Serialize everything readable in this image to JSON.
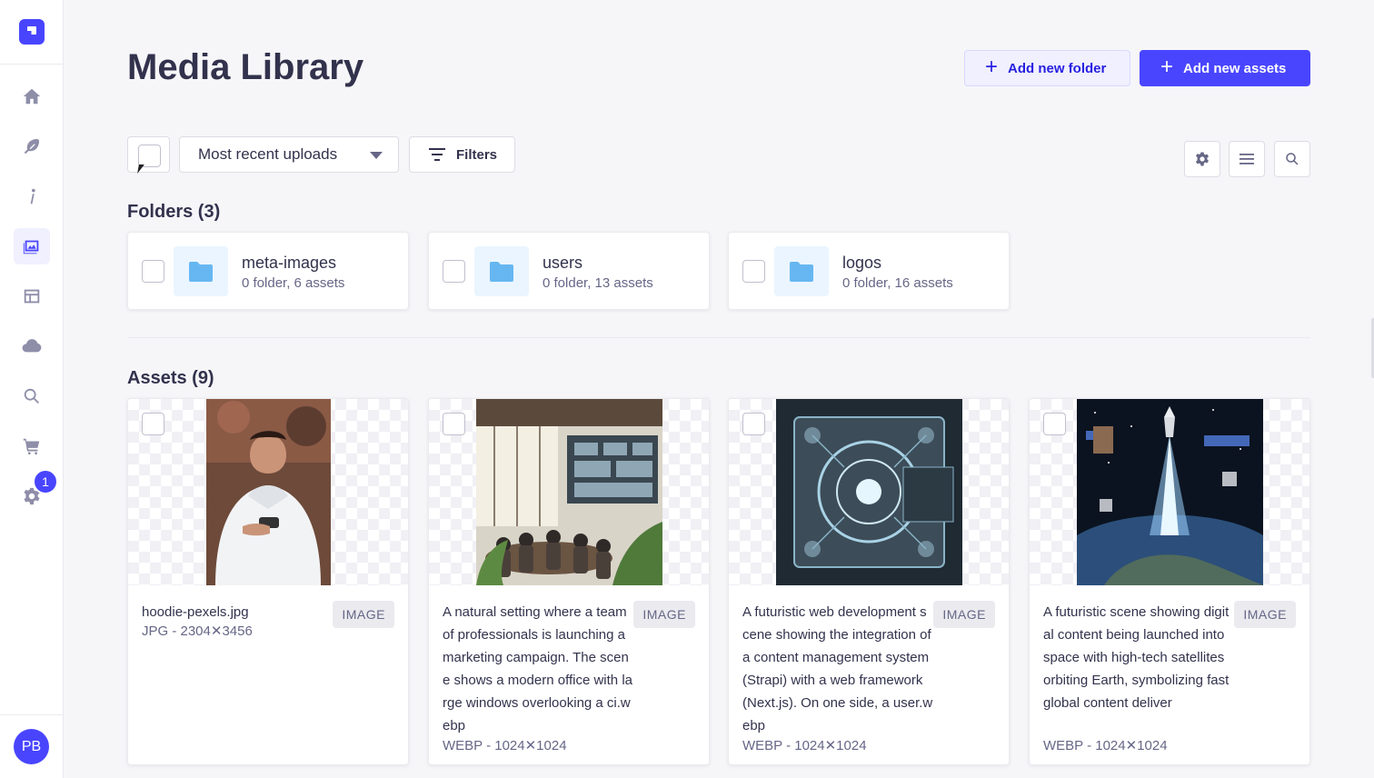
{
  "sidebar": {
    "nav": [
      "home",
      "content-manager",
      "info",
      "media-library",
      "content-type-builder",
      "cloud",
      "search",
      "marketplace",
      "settings"
    ],
    "settings_badge": "1",
    "user_initials": "PB"
  },
  "header": {
    "title": "Media Library",
    "add_folder_label": "Add new folder",
    "add_assets_label": "Add new assets"
  },
  "toolbar": {
    "sort_value": "Most recent uploads",
    "filters_label": "Filters"
  },
  "folders": {
    "heading": "Folders (3)",
    "items": [
      {
        "name": "meta-images",
        "meta": "0 folder, 6 assets"
      },
      {
        "name": "users",
        "meta": "0 folder, 13 assets"
      },
      {
        "name": "logos",
        "meta": "0 folder, 16 assets"
      }
    ]
  },
  "assets": {
    "heading": "Assets (9)",
    "items": [
      {
        "title": "hoodie-pexels.jpg",
        "meta": "JPG - 2304✕3456",
        "type": "IMAGE"
      },
      {
        "title": "A natural setting where a team of professionals is launching a marketing campaign. The scene shows a modern office with large windows overlooking a ci.webp",
        "meta": "WEBP - 1024✕1024",
        "type": "IMAGE"
      },
      {
        "title": "A futuristic web development scene showing the integration of a content management system (Strapi) with a web framework (Next.js). On one side, a user.webp",
        "meta": "WEBP - 1024✕1024",
        "type": "IMAGE"
      },
      {
        "title": "A futuristic scene showing digital content being launched into space with high-tech satellites orbiting Earth, symbolizing fast global content deliver",
        "meta": "WEBP - 1024✕1024",
        "type": "IMAGE"
      }
    ]
  },
  "colors": {
    "primary": "#4945ff",
    "primary_light": "#f0f0ff",
    "text": "#32324d",
    "muted": "#666687",
    "background": "#f6f6f9"
  }
}
